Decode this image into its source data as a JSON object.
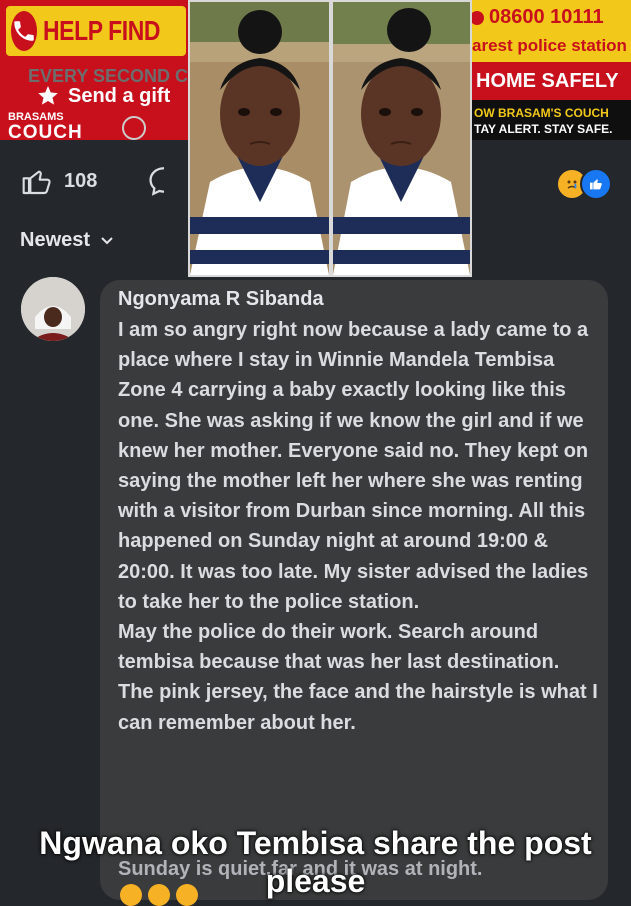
{
  "banner": {
    "help_title": "HELP FIND",
    "every_second": "EVERY SECOND C",
    "send_gift": "Send a gift",
    "brand_top": "BRASAMS",
    "brand_main": "COUCH",
    "phone_number": "08600 10111",
    "police_station": "arest police station",
    "home_safely": "HOME SAFELY",
    "follow": "OW BRASAM'S COUCH",
    "stay_alert": "TAY ALERT. STAY SAFE."
  },
  "actions": {
    "like_count": "108"
  },
  "sort": {
    "label": "Newest"
  },
  "comment": {
    "author": "Ngonyama R Sibanda",
    "text": "I am so angry right now because a lady came to a place where I stay in Winnie Mandela Tembisa Zone 4 carrying a baby exactly looking like this one. She was asking if we know the girl and if we knew her mother. Everyone said no. They kept on saying the mother left her where she was renting with a visitor from Durban since morning. All this happened on Sunday night at around 19:00 & 20:00.  It was too late. My sister advised  the ladies to take her to the police station.\n May the police do their work. Search around tembisa because that was her last destination. The pink jersey, the face and the hairstyle is what I can remember about her.",
    "cut_line": "Sunday is quiet,far and it was at night."
  },
  "overlay": {
    "caption": "Ngwana oko Tembisa share the post please"
  },
  "colors": {
    "background": "#24272b",
    "bubble": "#3a3b3c",
    "banner_red": "#c8101d",
    "banner_yellow": "#f2c91a",
    "like_blue": "#1877f2"
  },
  "icons": [
    "phone-icon",
    "gift-star-icon",
    "menu-icon",
    "thumbs-up-icon",
    "comment-icon",
    "sad-reaction-icon",
    "like-reaction-icon",
    "chevron-down-icon"
  ]
}
